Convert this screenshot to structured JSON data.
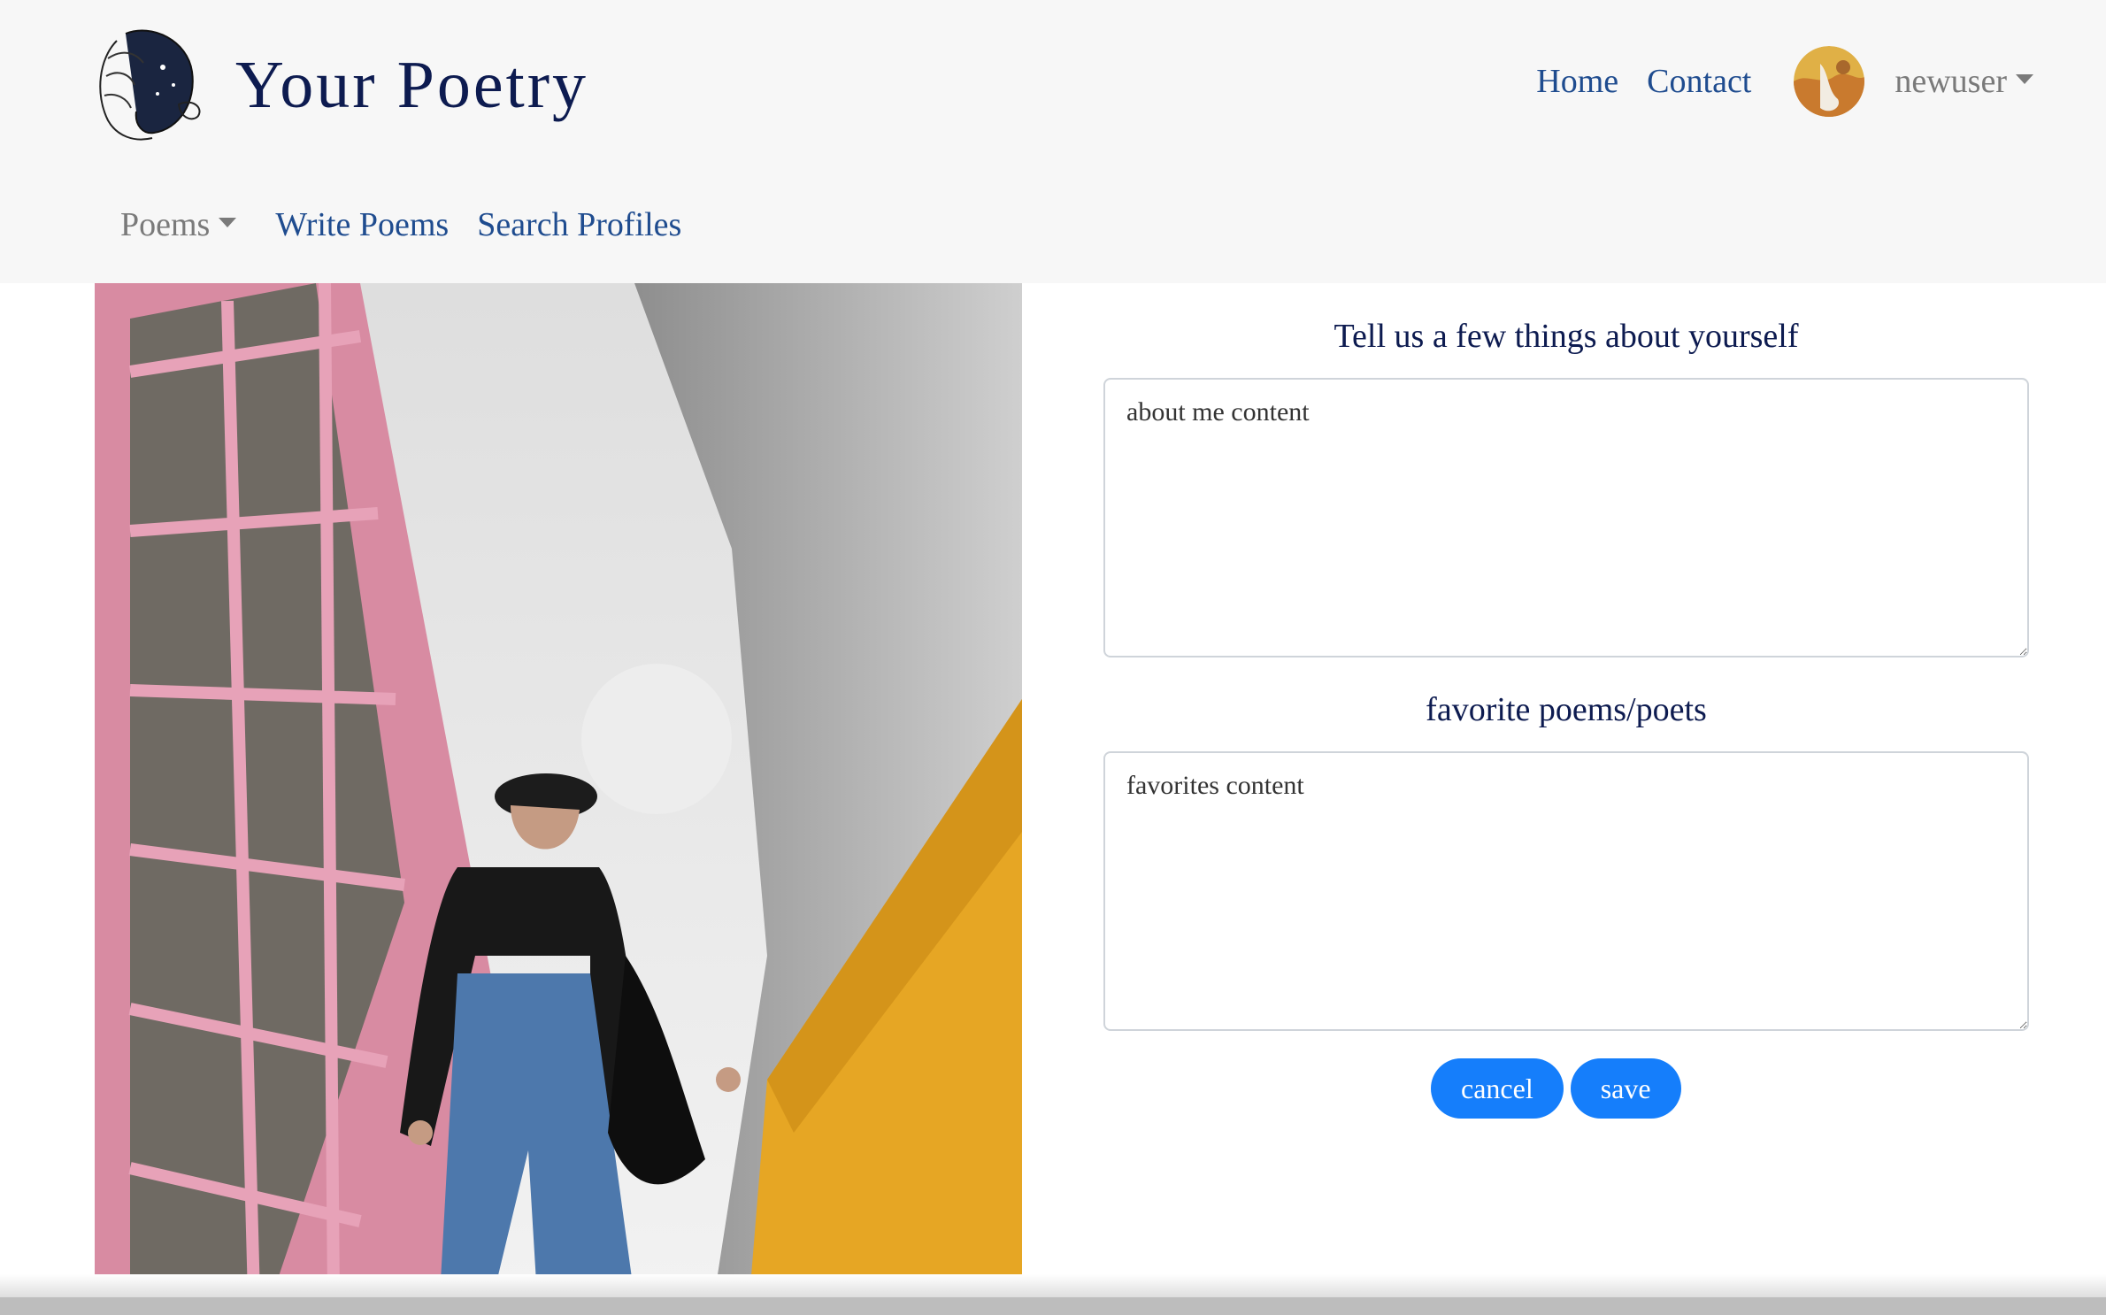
{
  "brand": {
    "title": "Your Poetry",
    "logo_icon": "poet-face-logo-icon"
  },
  "nav_right": {
    "home": "Home",
    "contact": "Contact",
    "username": "newuser",
    "avatar_icon": "user-avatar-icon"
  },
  "nav_left": {
    "poems": "Poems",
    "write": "Write Poems",
    "search": "Search Profiles"
  },
  "form": {
    "about_label": "Tell us a few things about yourself",
    "about_value": "about me content",
    "favorites_label": "favorite poems/poets",
    "favorites_value": "favorites content",
    "cancel": "cancel",
    "save": "save"
  },
  "colors": {
    "brand": "#0d1b50",
    "link": "#1f4c8f",
    "button": "#157efb",
    "navbar_bg": "#f7f7f7"
  }
}
